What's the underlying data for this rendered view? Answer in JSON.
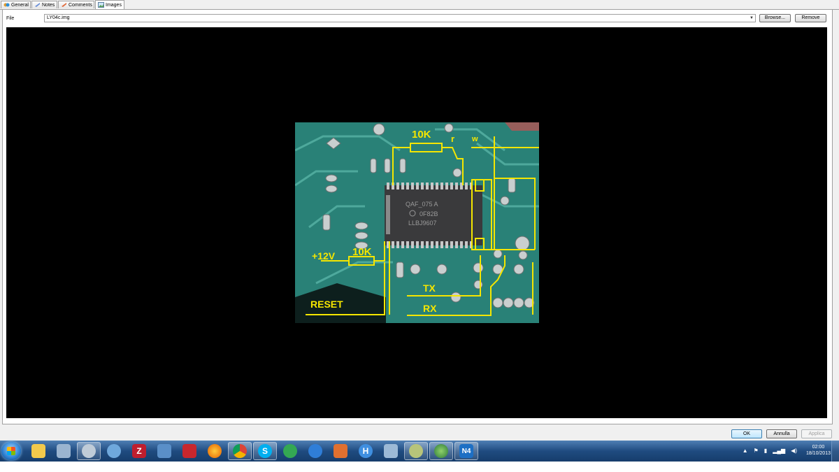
{
  "tabs": [
    {
      "label": "General",
      "icon": "general-icon"
    },
    {
      "label": "Notes",
      "icon": "notes-icon"
    },
    {
      "label": "Comments",
      "icon": "comments-icon"
    },
    {
      "label": "Images",
      "icon": "images-icon",
      "active": true
    }
  ],
  "file": {
    "label": "File",
    "value": "LY04c.img",
    "browse_label": "Browse...",
    "remove_label": "Remove"
  },
  "image": {
    "chip_line1": "QAF_075  A",
    "chip_line2": "0F82B",
    "chip_line3": "LLBJ9607",
    "label_10k_top": "10K",
    "label_r": "r",
    "label_w": "w",
    "label_12v": "+12V",
    "label_10k_bottom": "10K",
    "label_tx": "TX",
    "label_reset": "RESET",
    "label_rx": "RX",
    "annotation_color": "#f5e600",
    "board_color": "#2f8a80"
  },
  "dialog_buttons": {
    "ok": "OK",
    "cancel": "Annulla",
    "apply": "Applica"
  },
  "taskbar": {
    "apps": [
      "explorer-icon",
      "calculator-icon",
      "app-icon",
      "sync-icon",
      "filezilla-icon",
      "network-icon",
      "adobe-icon",
      "firefox-icon",
      "chrome-icon",
      "skype-icon",
      "tripadvisor-icon",
      "accessibility-icon",
      "bug-icon",
      "h-icon",
      "screen-icon",
      "bottle-icon",
      "earth-icon",
      "n4-icon"
    ],
    "n4_label": "N4",
    "time": "02:00",
    "date": "18/10/2013"
  }
}
